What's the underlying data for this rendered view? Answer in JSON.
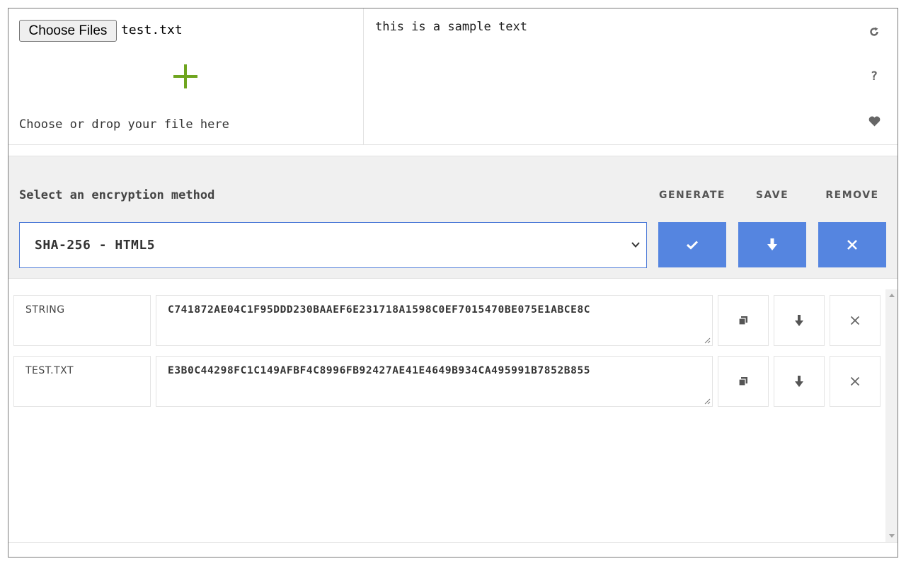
{
  "file_input": {
    "button_label": "Choose Files",
    "file_name": "test.txt",
    "drop_hint": "Choose or drop your file here"
  },
  "text_input": {
    "value": "this is a sample text"
  },
  "side_icons": [
    "refresh-icon",
    "help-icon",
    "heart-icon"
  ],
  "method": {
    "label": "Select an encryption method",
    "selected": "SHA-256 - HTML5"
  },
  "actions": {
    "generate": "GENERATE",
    "save": "SAVE",
    "remove": "REMOVE"
  },
  "results": [
    {
      "name": "STRING",
      "hash": "C741872AE04C1F95DDD230BAAEF6E231718A1598C0EF7015470BE075E1ABCE8C"
    },
    {
      "name": "TEST.TXT",
      "hash": "E3B0C44298FC1C149AFBF4C8996FB92427AE41E4649B934CA495991B7852B855"
    }
  ],
  "colors": {
    "accent": "#5585e0",
    "plus": "#6fa51f",
    "panel": "#f0f0f0"
  }
}
